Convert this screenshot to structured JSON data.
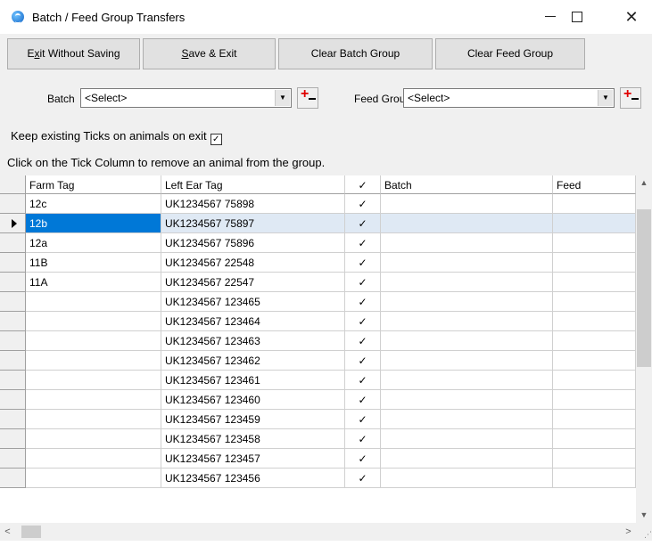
{
  "window": {
    "title": "Batch / Feed Group Transfers",
    "icon": "app-logo-icon",
    "controls": {
      "minimize": "minimize-icon",
      "maximize": "maximize-icon",
      "close": "close-icon"
    }
  },
  "toolbar": {
    "exit_without_saving": {
      "pre": "E",
      "accel": "x",
      "post": "it Without Saving"
    },
    "save_exit": {
      "pre": "",
      "accel": "S",
      "post": "ave & Exit"
    },
    "clear_batch_group": "Clear Batch Group",
    "clear_feed_group": "Clear Feed Group"
  },
  "filters": {
    "batch_label": "Batch",
    "batch_value": "<Select>",
    "feed_group_label": "Feed Grou",
    "feed_group_value": "<Select>"
  },
  "options": {
    "keep_ticks_label": "Keep existing Ticks on animals on exit",
    "keep_ticks_checked": true,
    "hint": "Click on the Tick Column to remove an animal from the group."
  },
  "grid": {
    "columns": [
      "Farm Tag",
      "Left Ear Tag",
      "✓",
      "Batch",
      "Feed"
    ],
    "rows": [
      {
        "farm_tag": "12c",
        "left_ear_tag": "UK1234567 75898",
        "tick": "✓",
        "batch": "",
        "feed": ""
      },
      {
        "farm_tag": "12b",
        "left_ear_tag": "UK1234567 75897",
        "tick": "✓",
        "batch": "",
        "feed": ""
      },
      {
        "farm_tag": "12a",
        "left_ear_tag": "UK1234567 75896",
        "tick": "✓",
        "batch": "",
        "feed": ""
      },
      {
        "farm_tag": "11B",
        "left_ear_tag": "UK1234567 22548",
        "tick": "✓",
        "batch": "",
        "feed": ""
      },
      {
        "farm_tag": "11A",
        "left_ear_tag": "UK1234567 22547",
        "tick": "✓",
        "batch": "",
        "feed": ""
      },
      {
        "farm_tag": "",
        "left_ear_tag": "UK1234567 123465",
        "tick": "✓",
        "batch": "",
        "feed": ""
      },
      {
        "farm_tag": "",
        "left_ear_tag": "UK1234567 123464",
        "tick": "✓",
        "batch": "",
        "feed": ""
      },
      {
        "farm_tag": "",
        "left_ear_tag": "UK1234567 123463",
        "tick": "✓",
        "batch": "",
        "feed": ""
      },
      {
        "farm_tag": "",
        "left_ear_tag": "UK1234567 123462",
        "tick": "✓",
        "batch": "",
        "feed": ""
      },
      {
        "farm_tag": "",
        "left_ear_tag": "UK1234567 123461",
        "tick": "✓",
        "batch": "",
        "feed": ""
      },
      {
        "farm_tag": "",
        "left_ear_tag": "UK1234567 123460",
        "tick": "✓",
        "batch": "",
        "feed": ""
      },
      {
        "farm_tag": "",
        "left_ear_tag": "UK1234567 123459",
        "tick": "✓",
        "batch": "",
        "feed": ""
      },
      {
        "farm_tag": "",
        "left_ear_tag": "UK1234567 123458",
        "tick": "✓",
        "batch": "",
        "feed": ""
      },
      {
        "farm_tag": "",
        "left_ear_tag": "UK1234567 123457",
        "tick": "✓",
        "batch": "",
        "feed": ""
      },
      {
        "farm_tag": "",
        "left_ear_tag": "UK1234567 123456",
        "tick": "✓",
        "batch": "",
        "feed": ""
      }
    ],
    "selected_row": 1
  },
  "colors": {
    "selection": "#0078d7",
    "selected_row": "#dfe9f4",
    "panel": "#f0f0f0",
    "add_plus": "#e00000"
  }
}
